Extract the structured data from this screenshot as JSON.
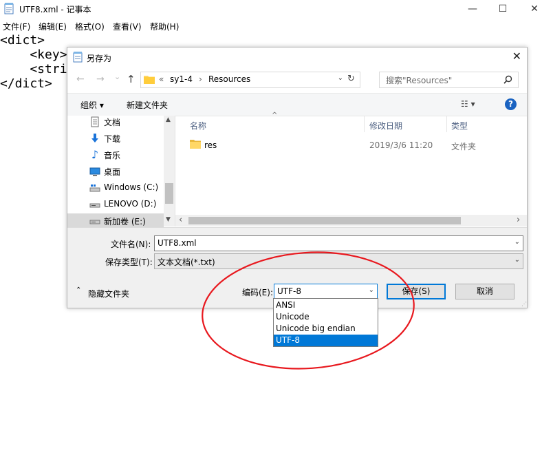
{
  "notepad": {
    "title": "UTF8.xml - 记事本",
    "window_controls": {
      "minimize": "—",
      "maximize": "☐",
      "close": "✕"
    },
    "menu": [
      "文件(F)",
      "编辑(E)",
      "格式(O)",
      "查看(V)",
      "帮助(H)"
    ],
    "text_lines": [
      "<dict>",
      "    <key>",
      "    <stri",
      "</dict>"
    ]
  },
  "dialog": {
    "title": "另存为",
    "close": "✕",
    "nav_buttons": {
      "back": "←",
      "forward": "→",
      "recent": "⌄",
      "up": "↑"
    },
    "address": {
      "overflow": "«",
      "segments": [
        "sy1-4",
        "›",
        "Resources"
      ],
      "refresh": "↻"
    },
    "search": {
      "placeholder": "搜索\"Resources\"",
      "icon": "search-icon"
    },
    "toolbar": {
      "organize": "组织 ▾",
      "new_folder": "新建文件夹",
      "view": "☷ ▾",
      "help": "?"
    },
    "nav_pane": {
      "items": [
        {
          "label": "文档",
          "icon": "document-icon"
        },
        {
          "label": "下载",
          "icon": "download-icon"
        },
        {
          "label": "音乐",
          "icon": "music-icon"
        },
        {
          "label": "桌面",
          "icon": "desktop-icon"
        },
        {
          "label": "Windows (C:)",
          "icon": "drive-icon"
        },
        {
          "label": "LENOVO (D:)",
          "icon": "drive-icon"
        },
        {
          "label": "新加卷 (E:)",
          "icon": "drive-icon"
        }
      ],
      "scroll_up": "▲",
      "scroll_down": "▼"
    },
    "file_list": {
      "columns": [
        "名称",
        "修改日期",
        "类型"
      ],
      "rows": [
        {
          "name": "res",
          "date": "2019/3/6 11:20",
          "type": "文件夹"
        }
      ],
      "scroll_left": "‹",
      "scroll_right": "›"
    },
    "filename_label": "文件名(N):",
    "filename_value": "UTF8.xml",
    "filetype_label": "保存类型(T):",
    "filetype_value": "文本文档(*.txt)",
    "hide_folders": "隐藏文件夹",
    "encoding_label": "编码(E):",
    "encoding_value": "UTF-8",
    "encoding_options": [
      "ANSI",
      "Unicode",
      "Unicode big endian",
      "UTF-8"
    ],
    "save_button": "保存(S)",
    "cancel_button": "取消"
  },
  "colors": {
    "accent": "#0078d7",
    "annotation_circle": "#e8181e",
    "folder": "#ffd766"
  }
}
